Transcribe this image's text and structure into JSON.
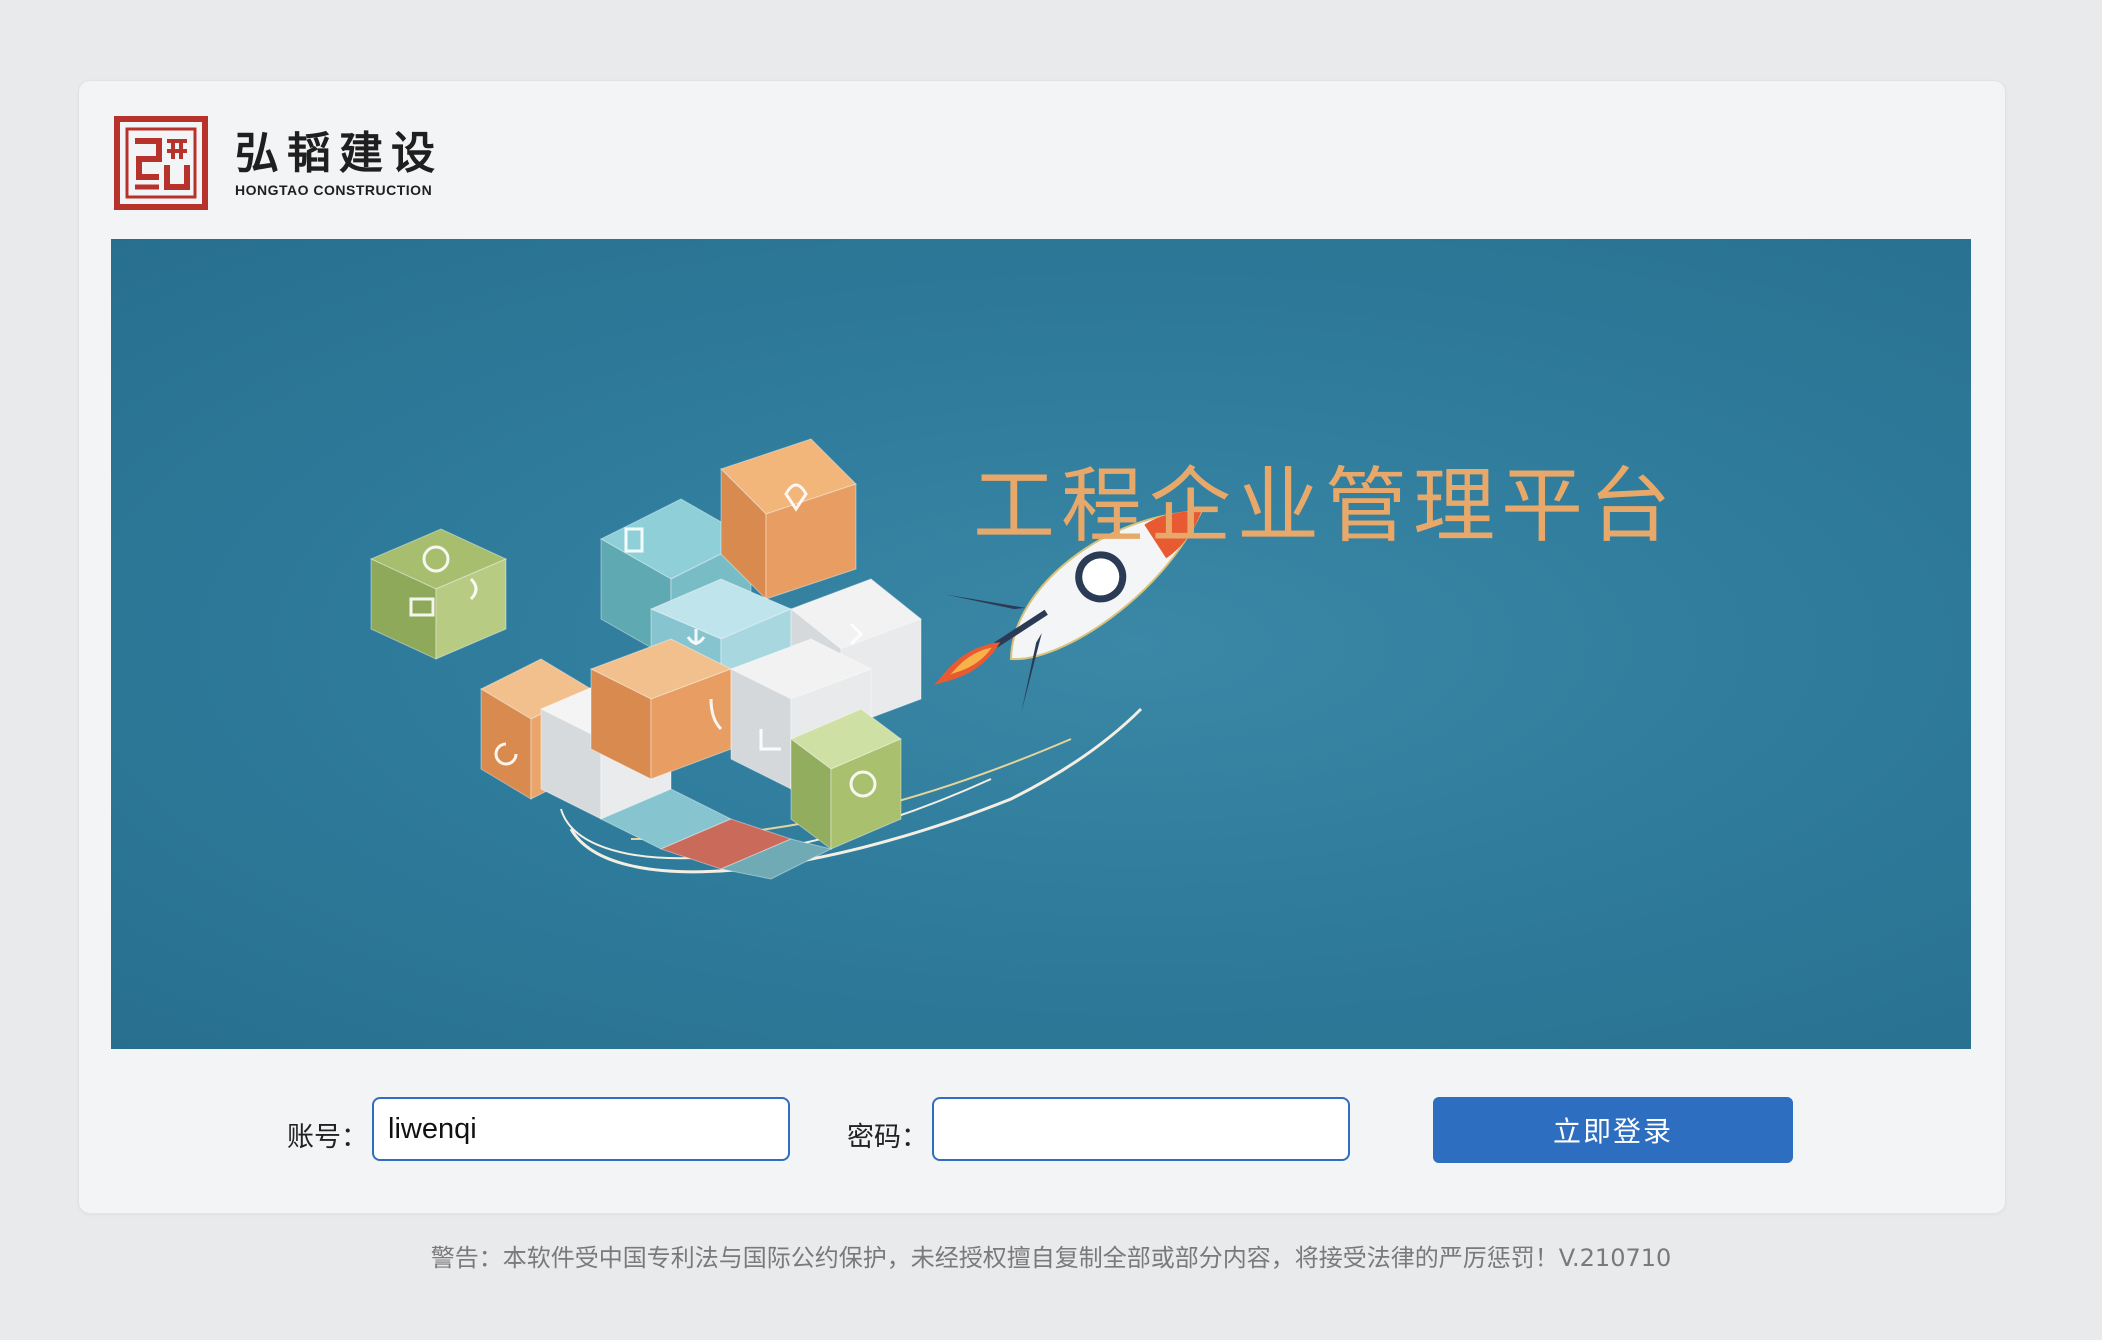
{
  "brand": {
    "name_cn": "弘韬建设",
    "name_en": "HONGTAO CONSTRUCTION",
    "logo_color": "#b8322c"
  },
  "banner": {
    "title": "工程企业管理平台",
    "background_color": "#2f7c9c",
    "title_color": "#e8a86a"
  },
  "login": {
    "account_label": "账号：",
    "account_value": "liwenqi",
    "password_label": "密码：",
    "password_value": "",
    "submit_label": "立即登录",
    "accent_color": "#2d6ec0"
  },
  "footer": {
    "notice": "警告：本软件受中国专利法与国际公约保护，未经授权擅自复制全部或部分内容，将接受法律的严厉惩罚！V.210710"
  }
}
